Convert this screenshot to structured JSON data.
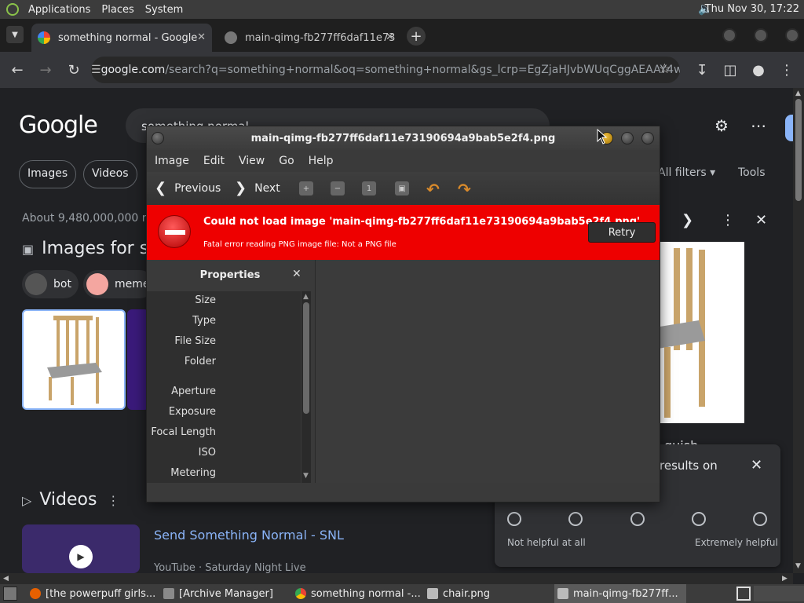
{
  "system_panel": {
    "menus": [
      "Applications",
      "Places",
      "System"
    ],
    "clock": "Thu Nov 30, 17:22"
  },
  "browser": {
    "tabs": [
      {
        "title": "something normal - Google",
        "active": true
      },
      {
        "title": "main-qimg-fb277ff6daf11e73",
        "active": false
      }
    ],
    "url_host": "google.com",
    "url_rest": "/search?q=something+normal&oq=something+normal&gs_lcrp=EgZjaHJvbWUqCggAEAAY4w..."
  },
  "google": {
    "logo": "Google",
    "search_value": "something normal",
    "chips": [
      "Images",
      "Videos"
    ],
    "filters": [
      "All filters",
      "Tools"
    ],
    "result_count": "About 9,480,000,000 re",
    "images_heading": "Images for so",
    "pills": [
      "bot",
      "meme"
    ],
    "videos_heading": "Videos",
    "video_title": "Send Something Normal - SNL",
    "video_meta": "YouTube · Saturday Night Live",
    "partial_text": "guish"
  },
  "feedback": {
    "title": "results on",
    "left_label": "Not helpful at all",
    "right_label": "Extremely helpful"
  },
  "viewer": {
    "title": "main-qimg-fb277ff6daf11e73190694a9bab5e2f4.png",
    "menus": [
      "Image",
      "Edit",
      "View",
      "Go",
      "Help"
    ],
    "previous": "Previous",
    "next": "Next",
    "error_title": "Could not load image 'main-qimg-fb277ff6daf11e73190694a9bab5e2f4.png'.",
    "error_detail": "Fatal error reading PNG image file: Not a PNG file",
    "retry": "Retry",
    "properties_title": "Properties",
    "properties": [
      "Size",
      "Type",
      "File Size",
      "Folder",
      "Aperture",
      "Exposure",
      "Focal Length",
      "ISO",
      "Metering"
    ]
  },
  "taskbar": {
    "tasks": [
      {
        "label": "[the powerpuff girls...",
        "active": false
      },
      {
        "label": "[Archive Manager]",
        "active": false
      },
      {
        "label": "something normal -...",
        "active": false
      },
      {
        "label": "chair.png",
        "active": false
      },
      {
        "label": "main-qimg-fb277ff...",
        "active": true
      }
    ]
  },
  "colors": {
    "error_bg": "#ee0000",
    "link": "#8ab4f8",
    "page_bg": "#202124"
  }
}
